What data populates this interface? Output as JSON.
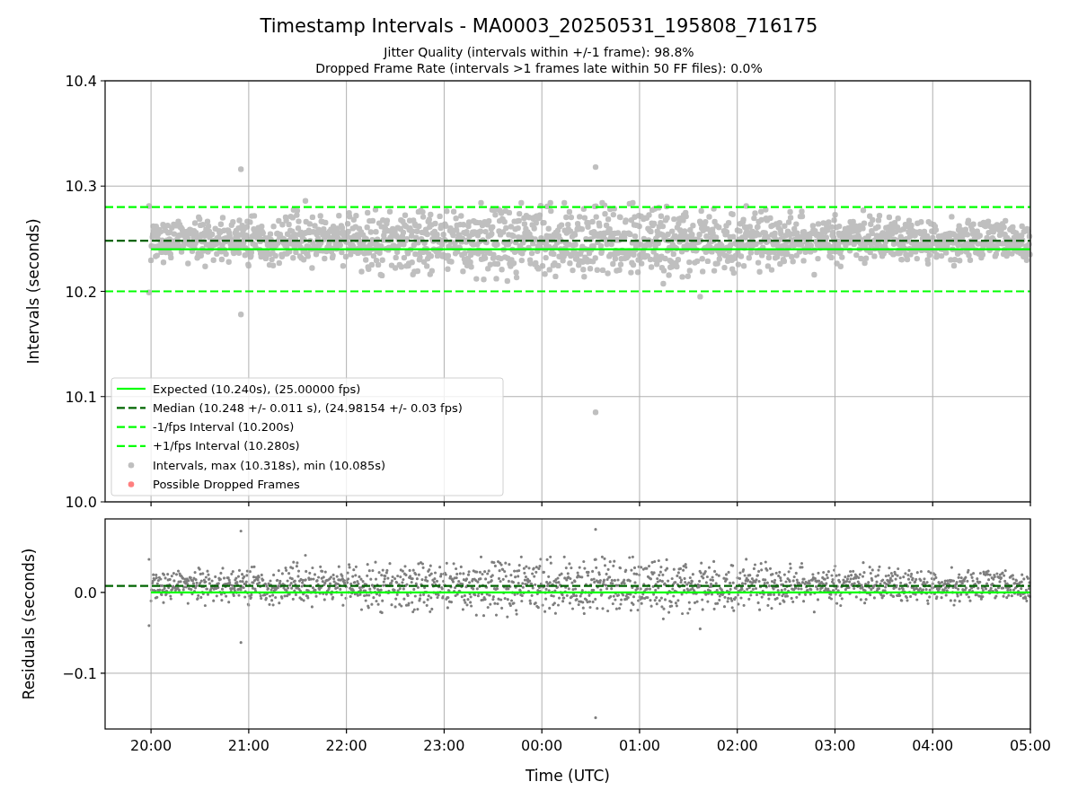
{
  "figure": {
    "title": "Timestamp Intervals - MA0003_20250531_195808_716175",
    "subtitles": [
      "Jitter Quality (intervals within +/-1 frame): 98.8%",
      "Dropped Frame Rate (intervals >1 frames late within 50 FF files): 0.0%"
    ]
  },
  "intervals_panel": {
    "chart_data": {
      "type": "scatter",
      "ylabel": "Intervals (seconds)",
      "categories": [
        null,
        null,
        null,
        null,
        null,
        null,
        null,
        null,
        null,
        null
      ],
      "grid": true,
      "legend": true,
      "ylim": [
        10.0,
        10.4
      ],
      "yticks": [
        {
          "value": 10.0,
          "label": "10.0"
        },
        {
          "value": 10.1,
          "label": "10.1"
        },
        {
          "value": 10.2,
          "label": "10.2"
        },
        {
          "value": 10.3,
          "label": "10.3"
        },
        {
          "value": 10.4,
          "label": "10.4"
        }
      ],
      "series": [
        {
          "name": "Expected (10.240s), (25.00000 fps)",
          "color": "#00ff00",
          "type": "line",
          "values": [
            10.24,
            10.24,
            10.24,
            10.24,
            10.24,
            10.24,
            10.24,
            10.24,
            10.24,
            10.24
          ]
        },
        {
          "name": "Intervals, max (10.318s), min (10.085s)",
          "color": "#808080",
          "type": "scatter",
          "values": [
            null,
            null,
            null,
            null,
            null,
            null,
            null,
            null,
            null,
            null
          ]
        },
        {
          "name": "Possible Dropped Frames",
          "color": "#ff0000",
          "type": "scatter",
          "values": [
            null,
            null,
            null,
            null,
            null,
            null,
            null,
            null,
            null,
            null
          ]
        }
      ],
      "ref_lines": [
        {
          "label": "Median (10.248 +/- 0.011 s), (24.98154 +/- 0.03 fps)",
          "axis": "y",
          "value": 10.248,
          "color": "#006400"
        },
        {
          "label": "-1/fps Interval (10.200s)",
          "axis": "y",
          "value": 10.2,
          "color": "#00ff00"
        },
        {
          "label": "+1/fps Interval (10.280s)",
          "axis": "y",
          "value": 10.28,
          "color": "#00ff00"
        }
      ]
    }
  },
  "residuals_panel": {
    "chart_data": {
      "type": "scatter",
      "xlabel": "Time (UTC)",
      "ylabel": "Residuals (seconds)",
      "categories": [
        "20:00",
        "21:00",
        "22:00",
        "23:00",
        "00:00",
        "01:00",
        "02:00",
        "03:00",
        "04:00",
        "05:00"
      ],
      "grid": true,
      "ylim": [
        -0.169,
        0.091
      ],
      "yticks": [
        {
          "value": -0.1,
          "label": "−0.1"
        },
        {
          "value": 0,
          "label": "0.0"
        }
      ],
      "series": [
        {
          "color": "#00ff00",
          "type": "line",
          "values": [
            0,
            0,
            0,
            0,
            0,
            0,
            0,
            0,
            0,
            0
          ]
        },
        {
          "color": "#707070",
          "type": "scatter",
          "values": [
            null,
            null,
            null,
            null,
            null,
            null,
            null,
            null,
            null,
            null
          ]
        }
      ],
      "ref_lines": [
        {
          "axis": "y",
          "value": 0.008,
          "color": "#006400"
        }
      ]
    }
  }
}
